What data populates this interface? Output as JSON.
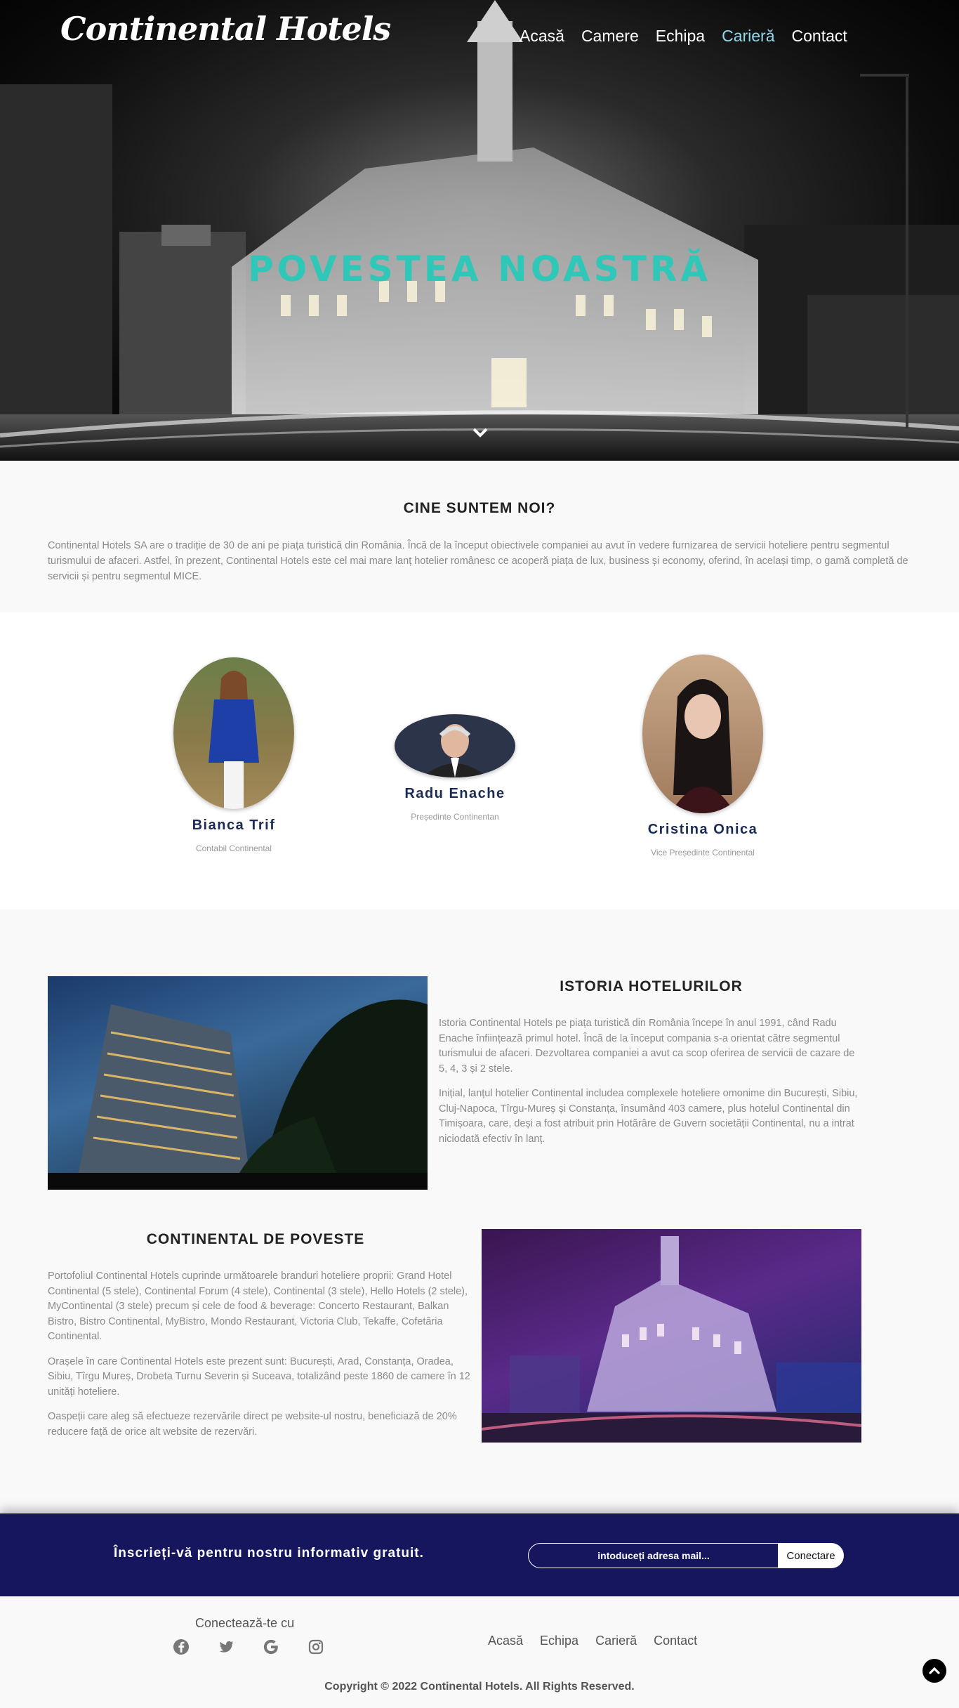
{
  "header": {
    "logo": "Continental Hotels",
    "nav": [
      {
        "label": "Acasă",
        "active": false
      },
      {
        "label": "Camere",
        "active": false
      },
      {
        "label": "Echipa",
        "active": false
      },
      {
        "label": "Carieră",
        "active": true
      },
      {
        "label": "Contact",
        "active": false
      }
    ]
  },
  "hero": {
    "title": "POVESTEA NOASTRĂ",
    "scroll_icon": "chevron-down-icon"
  },
  "about": {
    "title": "CINE SUNTEM NOI?",
    "text": "Continental Hotels SA are o tradiție de 30 de ani pe piața turistică din România. Încă de la început obiectivele companiei au avut în vedere furnizarea de servicii hoteliere pentru segmentul turismului de afaceri. Astfel, în prezent, Continental Hotels este cel mai mare lanț hotelier românesc ce acoperă piața de lux, business și economy, oferind, în același timp, o gamă completă de servicii și pentru segmentul MICE."
  },
  "team": [
    {
      "name": "Bianca Trif",
      "role": "Contabil Continental"
    },
    {
      "name": "Radu Enache",
      "role": "Președinte Continentan"
    },
    {
      "name": "Cristina Onica",
      "role": "Vice Președinte Continental"
    }
  ],
  "history": {
    "title": "ISTORIA HOTELURILOR",
    "paragraphs": [
      "Istoria Continental Hotels pe piața turistică din România începe în anul 1991, când Radu Enache înființează primul hotel. Încă de la început compania s-a orientat către segmentul turismului de afaceri. Dezvoltarea companiei a avut ca scop oferirea de servicii de cazare de 5, 4, 3 și 2 stele.",
      "Inițial, lanțul hotelier Continental includea complexele hoteliere omonime din București, Sibiu, Cluj-Napoca, Tîrgu-Mureș și Constanța, însumând 403 camere, plus hotelul Continental din Timișoara, care, deși a fost atribuit prin Hotărâre de Guvern societății Continental, nu a intrat niciodată efectiv în lanț."
    ]
  },
  "story": {
    "title": "CONTINENTAL DE POVESTE",
    "paragraphs": [
      "Portofoliul Continental Hotels cuprinde următoarele branduri hoteliere proprii: Grand Hotel Continental (5 stele), Continental Forum (4 stele), Continental (3 stele), Hello Hotels (2 stele), MyContinental (3 stele) precum și cele de food & beverage: Concerto Restaurant, Balkan Bistro, Bistro Continental, MyBistro, Mondo Restaurant, Victoria Club, Tekaffe, Cofetăria Continental.",
      "Orașele în care Continental Hotels este prezent sunt: București, Arad, Constanța, Oradea, Sibiu, Tîrgu Mureș, Drobeta Turnu Severin și Suceava, totalizând peste 1860 de camere în 12 unități hoteliere.",
      "Oaspeții care aleg să efectueze rezervările direct pe website-ul nostru, beneficiază de 20% reducere față de orice alt website de rezervări."
    ]
  },
  "newsletter": {
    "label": "Înscrieți-vă pentru nostru informativ gratuit.",
    "placeholder": "intoduceți adresa mail...",
    "button": "Conectare"
  },
  "footer": {
    "connect_label": "Conectează-te cu",
    "socials": [
      "facebook-icon",
      "twitter-icon",
      "google-icon",
      "instagram-icon"
    ],
    "nav": [
      "Acasă",
      "Echipa",
      "Carieră",
      "Contact"
    ],
    "copyright": "Copyright © 2022 Continental Hotels. All Rights Reserved."
  },
  "colors": {
    "accent_title": "#2fc7b7",
    "active_nav": "#8fd9e8",
    "newsletter_bg": "#15165e",
    "team_name": "#1c2b55"
  }
}
